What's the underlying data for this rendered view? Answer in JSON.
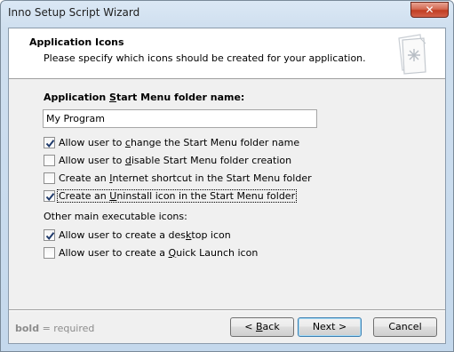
{
  "window": {
    "title": "Inno Setup Script Wizard",
    "close_glyph": "✕"
  },
  "header": {
    "title": "Application Icons",
    "subtitle": "Please specify which icons should be created for your application.",
    "icon": "document-star-icon"
  },
  "folder": {
    "label_pre": "Application ",
    "label_accel": "S",
    "label_post": "tart Menu folder name:",
    "value": "My Program"
  },
  "options": [
    {
      "pre": "Allow user to ",
      "accel": "c",
      "post": "hange the Start Menu folder name",
      "checked": true
    },
    {
      "pre": "Allow user to ",
      "accel": "d",
      "post": "isable Start Menu folder creation",
      "checked": false
    },
    {
      "pre": "Create an ",
      "accel": "I",
      "post": "nternet shortcut in the Start Menu folder",
      "checked": false
    },
    {
      "pre": "Create an ",
      "accel": "U",
      "post": "ninstall icon in the Start Menu folder",
      "checked": true
    }
  ],
  "other_label": "Other main executable icons:",
  "other_options": [
    {
      "pre": "Allow user to create a des",
      "accel": "k",
      "post": "top icon",
      "checked": true
    },
    {
      "pre": "Allow user to create a ",
      "accel": "Q",
      "post": "uick Launch icon",
      "checked": false
    }
  ],
  "footer": {
    "hint_bold": "bold",
    "hint_rest": " = required",
    "back_pre": "< ",
    "back_accel": "B",
    "back_post": "ack",
    "next_label": "Next >",
    "cancel_label": "Cancel"
  },
  "colors": {
    "check": "#1f3a6b",
    "hint": "#8c8c8c"
  }
}
